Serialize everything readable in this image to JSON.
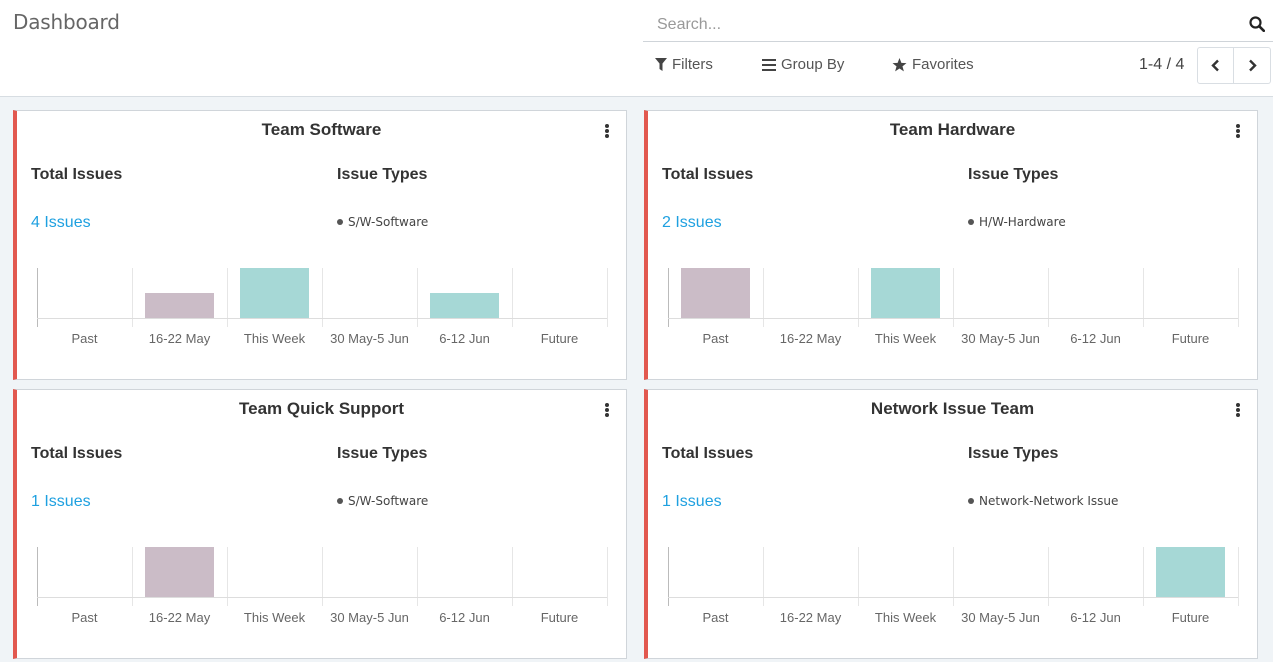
{
  "header": {
    "title": "Dashboard",
    "search_placeholder": "Search...",
    "filters_label": "Filters",
    "group_by_label": "Group By",
    "favorites_label": "Favorites",
    "pager": "1-4 / 4"
  },
  "colors": {
    "accent_border": "#e2584f",
    "link": "#1ea0e0",
    "bar_past": "#cbbcc7",
    "bar_current": "#a6d8d6"
  },
  "labels": {
    "total_issues": "Total Issues",
    "issue_types": "Issue Types"
  },
  "cards": [
    {
      "title": "Team Software",
      "issues": "4 Issues",
      "issue_type": "S/W-Software",
      "chart_data": {
        "type": "bar",
        "categories": [
          "Past",
          "16-22 May",
          "This Week",
          "30 May-5 Jun",
          "6-12 Jun",
          "Future"
        ],
        "values": [
          0,
          1,
          2,
          0,
          1,
          0
        ],
        "bar_colors": [
          "#cbbcc7",
          "#cbbcc7",
          "#a6d8d6",
          "#a6d8d6",
          "#a6d8d6",
          "#a6d8d6"
        ],
        "ylim": [
          0,
          2
        ]
      }
    },
    {
      "title": "Team Hardware",
      "issues": "2 Issues",
      "issue_type": "H/W-Hardware",
      "chart_data": {
        "type": "bar",
        "categories": [
          "Past",
          "16-22 May",
          "This Week",
          "30 May-5 Jun",
          "6-12 Jun",
          "Future"
        ],
        "values": [
          1,
          0,
          1,
          0,
          0,
          0
        ],
        "bar_colors": [
          "#cbbcc7",
          "#cbbcc7",
          "#a6d8d6",
          "#a6d8d6",
          "#a6d8d6",
          "#a6d8d6"
        ],
        "ylim": [
          0,
          1
        ]
      }
    },
    {
      "title": "Team Quick Support",
      "issues": "1 Issues",
      "issue_type": "S/W-Software",
      "chart_data": {
        "type": "bar",
        "categories": [
          "Past",
          "16-22 May",
          "This Week",
          "30 May-5 Jun",
          "6-12 Jun",
          "Future"
        ],
        "values": [
          0,
          1,
          0,
          0,
          0,
          0
        ],
        "bar_colors": [
          "#cbbcc7",
          "#cbbcc7",
          "#a6d8d6",
          "#a6d8d6",
          "#a6d8d6",
          "#a6d8d6"
        ],
        "ylim": [
          0,
          1
        ]
      }
    },
    {
      "title": "Network Issue Team",
      "issues": "1 Issues",
      "issue_type": "Network-Network Issue",
      "chart_data": {
        "type": "bar",
        "categories": [
          "Past",
          "16-22 May",
          "This Week",
          "30 May-5 Jun",
          "6-12 Jun",
          "Future"
        ],
        "values": [
          0,
          0,
          0,
          0,
          0,
          1
        ],
        "bar_colors": [
          "#cbbcc7",
          "#cbbcc7",
          "#a6d8d6",
          "#a6d8d6",
          "#a6d8d6",
          "#a6d8d6"
        ],
        "ylim": [
          0,
          1
        ]
      }
    }
  ]
}
